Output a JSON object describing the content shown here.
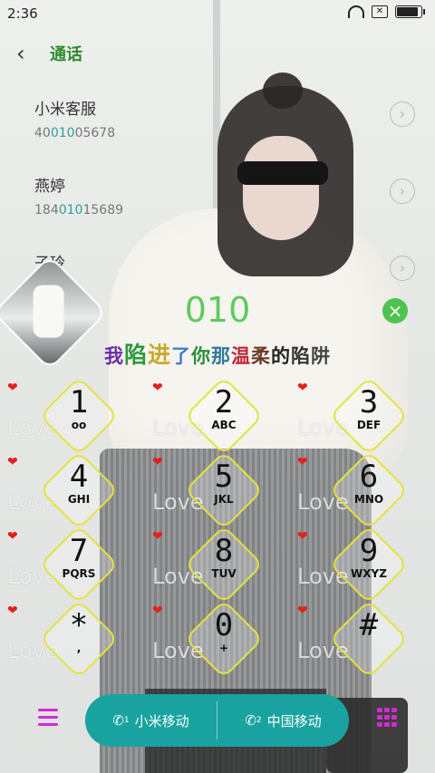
{
  "status_bar": {
    "time": "2:36",
    "battery_level": 0.95
  },
  "header": {
    "title": "通话"
  },
  "contacts": [
    {
      "name": "小米客服",
      "number_pre": "40",
      "number_hl": "010",
      "number_post": "05678"
    },
    {
      "name": "燕婷",
      "number_pre": "184",
      "number_hl": "010",
      "number_post": "15689"
    },
    {
      "name": "子玲"
    }
  ],
  "dialer": {
    "number": "010"
  },
  "slogan": {
    "chars": [
      "我",
      "陷",
      "进",
      "了",
      "你",
      "那",
      "温",
      "柔",
      "的",
      "陷",
      "阱"
    ]
  },
  "keypad": [
    {
      "digit": "1",
      "letters": "oo"
    },
    {
      "digit": "2",
      "letters": "ABC"
    },
    {
      "digit": "3",
      "letters": "DEF"
    },
    {
      "digit": "4",
      "letters": "GHI"
    },
    {
      "digit": "5",
      "letters": "JKL"
    },
    {
      "digit": "6",
      "letters": "MNO"
    },
    {
      "digit": "7",
      "letters": "PQRS"
    },
    {
      "digit": "8",
      "letters": "TUV"
    },
    {
      "digit": "9",
      "letters": "WXYZ"
    },
    {
      "digit": "*",
      "letters": ","
    },
    {
      "digit": "0",
      "letters": "+"
    },
    {
      "digit": "#",
      "letters": ""
    }
  ],
  "decoration": {
    "love_text": "Love",
    "heart": "❤"
  },
  "bottom": {
    "sim1_label": "小米移动",
    "sim1_num": "1",
    "sim2_label": "中国移动",
    "sim2_num": "2"
  },
  "colors": {
    "accent_green": "#2e8b2e",
    "call_teal": "#19a3a0",
    "magenta": "#d22bd2"
  }
}
